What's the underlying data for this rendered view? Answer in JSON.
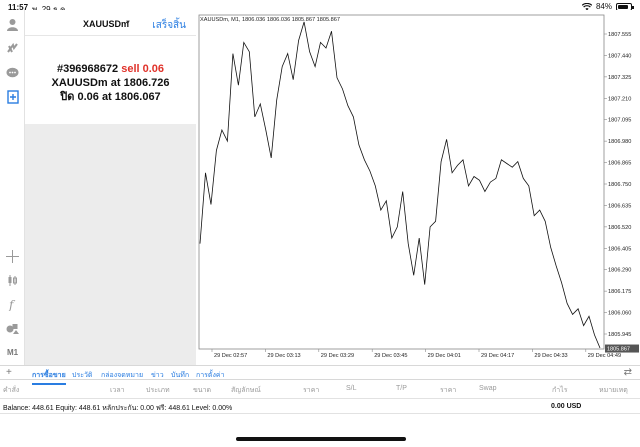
{
  "status_bar": {
    "time": "11:57",
    "date": "พ. 29 ธ.ค.",
    "battery": "84%",
    "battery_level": 0.84
  },
  "order": {
    "symbol": "XAUUSDm",
    "done_label": "เสร็จสิ้น",
    "ticket": "#396968672",
    "type_volume": "sell 0.06",
    "line2_prefix": "XAUUSDm at",
    "open_price": "1806.726",
    "line3_prefix": "ปิด 0.06 at",
    "close_price": "1806.067"
  },
  "chart": {
    "header": "XAUUSDm, M1, 1806.036 1806.036 1805.867 1805.867",
    "current_price_label": "1805.867"
  },
  "chart_data": {
    "type": "line",
    "title": "XAUUSDm, M1, 1806.036 1806.036 1805.867 1805.867",
    "y_ticks": [
      "1807.555",
      "1807.440",
      "1807.325",
      "1807.210",
      "1807.095",
      "1806.980",
      "1806.865",
      "1806.750",
      "1806.635",
      "1806.520",
      "1806.405",
      "1806.290",
      "1806.175",
      "1806.060",
      "1805.945"
    ],
    "x_ticks": [
      "29 Dec 02:57",
      "29 Dec 03:13",
      "29 Dec 03:29",
      "29 Dec 03:45",
      "29 Dec 04:01",
      "29 Dec 04:17",
      "29 Dec 04:33",
      "29 Dec 04:49"
    ],
    "ylim": [
      1805.867,
      1807.61
    ],
    "grid": false,
    "series": [
      {
        "values": [
          1806.43,
          1806.81,
          1806.64,
          1806.93,
          1807.04,
          1806.98,
          1807.45,
          1807.28,
          1807.51,
          1807.46,
          1807.11,
          1807.18,
          1807.04,
          1806.89,
          1807.2,
          1807.38,
          1807.45,
          1807.31,
          1807.52,
          1807.62,
          1807.46,
          1807.38,
          1807.51,
          1807.48,
          1807.57,
          1807.32,
          1807.26,
          1807.17,
          1807.11,
          1806.96,
          1806.88,
          1806.82,
          1806.74,
          1806.61,
          1806.66,
          1806.46,
          1806.52,
          1806.71,
          1806.43,
          1806.26,
          1806.46,
          1806.21,
          1806.52,
          1806.55,
          1806.87,
          1806.99,
          1806.81,
          1806.85,
          1806.88,
          1806.74,
          1806.79,
          1806.77,
          1806.71,
          1806.76,
          1806.78,
          1806.88,
          1806.86,
          1806.84,
          1806.87,
          1806.78,
          1806.74,
          1806.58,
          1806.61,
          1806.55,
          1806.41,
          1806.31,
          1806.22,
          1806.11,
          1806.05,
          1806.08,
          1805.99,
          1806.04,
          1805.94,
          1805.87
        ]
      }
    ]
  },
  "tabs": [
    "การซื้อขาย",
    "ประวัติ",
    "กล่องจดหมาย",
    "ข่าว",
    "บันทึก",
    "การตั้งค่า"
  ],
  "table_headers": [
    "คำสั่ง",
    "เวลา",
    "ประเภท",
    "ขนาด",
    "สัญลักษณ์",
    "ราคา",
    "S/L",
    "T/P",
    "ราคา",
    "Swap",
    "กำไร",
    "หมายเหตุ"
  ],
  "balance": {
    "text": "Balance: 448.61  Equity: 448.61  หลักประกัน: 0.00  ฟรี: 448.61  Level: 0.00%",
    "profit": "0.00  USD"
  }
}
